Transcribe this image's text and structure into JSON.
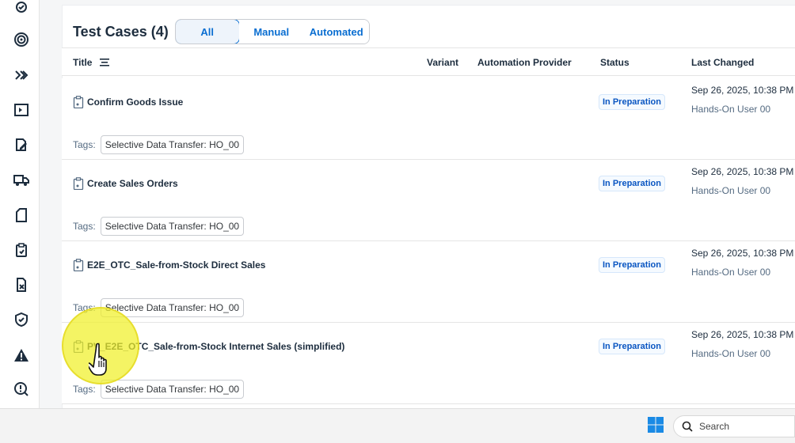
{
  "header": {
    "title": "Test Cases (4)",
    "filters": [
      {
        "label": "All",
        "active": true
      },
      {
        "label": "Manual",
        "active": false
      },
      {
        "label": "Automated",
        "active": false
      }
    ]
  },
  "table": {
    "columns": {
      "title": "Title",
      "variant": "Variant",
      "provider": "Automation Provider",
      "status": "Status",
      "changed": "Last Changed"
    },
    "tags_label": "Tags:",
    "rows": [
      {
        "title": "Confirm Goods Issue",
        "tag": "Selective Data Transfer: HO_00",
        "status": "In Preparation",
        "date": "Sep 26, 2025, 10:38 PM",
        "user": "Hands-On User 00"
      },
      {
        "title": "Create Sales Orders",
        "tag": "Selective Data Transfer: HO_00",
        "status": "In Preparation",
        "date": "Sep 26, 2025, 10:38 PM",
        "user": "Hands-On User 00"
      },
      {
        "title": "E2E_OTC_Sale-from-Stock Direct Sales",
        "tag": "Selective Data Transfer: HO_00",
        "status": "In Preparation",
        "date": "Sep 26, 2025, 10:38 PM",
        "user": "Hands-On User 00"
      },
      {
        "title": "PV_E2E_OTC_Sale-from-Stock Internet Sales (simplified)",
        "tag": "Selective Data Transfer: HO_00",
        "status": "In Preparation",
        "date": "Sep 26, 2025, 10:38 PM",
        "user": "Hands-On User 00"
      }
    ]
  },
  "sidebar": {
    "icons": [
      "settings-check-icon",
      "target-icon",
      "double-chevron-icon",
      "presentation-icon",
      "edit-document-icon",
      "truck-icon",
      "document-icon",
      "clipboard-check-icon",
      "document-x-icon",
      "shield-check-icon",
      "warning-icon",
      "search-question-icon"
    ]
  },
  "taskbar": {
    "search_placeholder": "Search"
  },
  "colors": {
    "accent": "#0a6ed1",
    "status_text": "#0a56c2",
    "highlight": "#f0f028"
  }
}
